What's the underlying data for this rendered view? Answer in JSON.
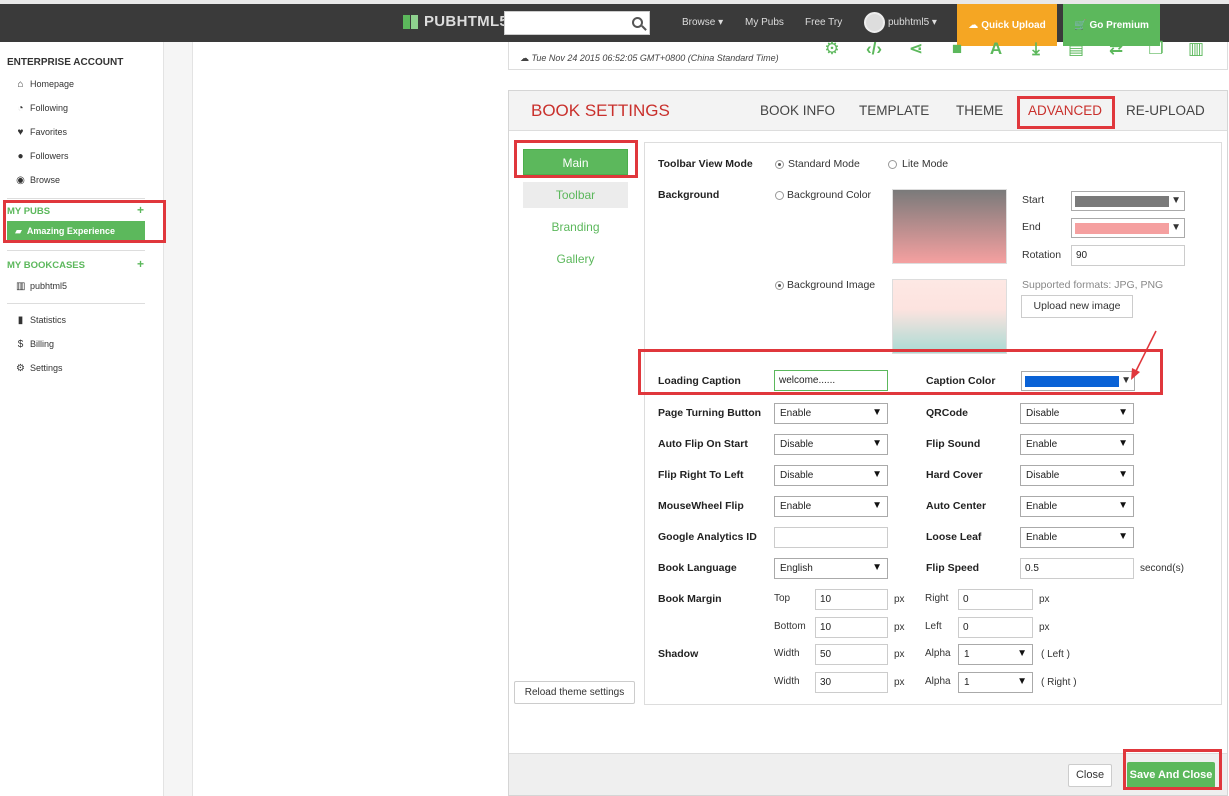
{
  "topbar": {
    "logo": "PUBHTML5",
    "search_placeholder": "",
    "nav": [
      "Browse ▾",
      "My Pubs",
      "Free Try"
    ],
    "user": "pubhtml5 ▾",
    "quick_upload": "Quick Upload",
    "go_premium": "Go Premium"
  },
  "sidebar": {
    "account_heading": "ENTERPRISE ACCOUNT",
    "items": [
      "Homepage",
      "Following",
      "Favorites",
      "Followers",
      "Browse"
    ],
    "my_pubs": "MY PUBS",
    "active_pub": "Amazing Experience",
    "my_bookcases": "MY BOOKCASES",
    "bookcase": "pubhtml5",
    "bottom_items": [
      "Statistics",
      "Billing",
      "Settings"
    ]
  },
  "date_text": "Tue Nov 24 2015 06:52:05 GMT+0800 (China Standard Time)",
  "toolbar_icons": [
    "gear-icon",
    "code-icon",
    "share-icon",
    "square-icon",
    "font-icon",
    "download-icon",
    "print-icon",
    "swap-icon",
    "copy-icon",
    "columns-icon"
  ],
  "panel": {
    "title": "BOOK SETTINGS",
    "tabs": [
      "BOOK INFO",
      "TEMPLATE",
      "THEME",
      "ADVANCED",
      "RE-UPLOAD"
    ],
    "active_tab": "ADVANCED",
    "subtabs": [
      "Main",
      "Toolbar",
      "Branding",
      "Gallery"
    ],
    "reload": "Reload theme settings",
    "close": "Close",
    "save": "Save And Close"
  },
  "form": {
    "toolbar_view_mode": {
      "label": "Toolbar View Mode",
      "opt1": "Standard Mode",
      "opt2": "Lite Mode"
    },
    "background": {
      "label": "Background",
      "color_opt": "Background Color",
      "image_opt": "Background Image",
      "start_label": "Start",
      "end_label": "End",
      "rotation_label": "Rotation",
      "rotation": "90",
      "start_color": "#7a7a7a",
      "end_color": "#f5a0a0",
      "formats": "Supported formats: JPG, PNG",
      "upload": "Upload new image"
    },
    "loading_caption": {
      "label": "Loading Caption",
      "value": "welcome......"
    },
    "caption_color": {
      "label": "Caption Color",
      "color": "#0a62d6"
    },
    "rows_left": [
      {
        "label": "Page Turning Button",
        "value": "Enable"
      },
      {
        "label": "Auto Flip On Start",
        "value": "Disable"
      },
      {
        "label": "Flip Right To Left",
        "value": "Disable"
      },
      {
        "label": "MouseWheel Flip",
        "value": "Enable"
      },
      {
        "label": "Google Analytics ID",
        "value": ""
      },
      {
        "label": "Book Language",
        "value": "English"
      }
    ],
    "rows_right": [
      {
        "label": "QRCode",
        "value": "Disable"
      },
      {
        "label": "Flip Sound",
        "value": "Enable"
      },
      {
        "label": "Hard Cover",
        "value": "Disable"
      },
      {
        "label": "Auto Center",
        "value": "Enable"
      },
      {
        "label": "Loose Leaf",
        "value": "Enable"
      },
      {
        "label": "Flip Speed",
        "value": "0.5",
        "unit": "second(s)"
      }
    ],
    "book_margin": {
      "label": "Book Margin",
      "top_label": "Top",
      "top": "10",
      "right_label": "Right",
      "right": "0",
      "bottom_label": "Bottom",
      "bottom": "10",
      "left_label": "Left",
      "left": "0",
      "unit": "px"
    },
    "shadow": {
      "label": "Shadow",
      "width_label": "Width",
      "alpha_label": "Alpha",
      "width1": "50",
      "alpha1": "1",
      "side1": "( Left )",
      "width2": "30",
      "alpha2": "1",
      "side2": "( Right )",
      "unit": "px"
    }
  },
  "colors": {
    "accent": "#5cb85c",
    "title_red": "#c9302c",
    "highlight": "#e0373c"
  }
}
